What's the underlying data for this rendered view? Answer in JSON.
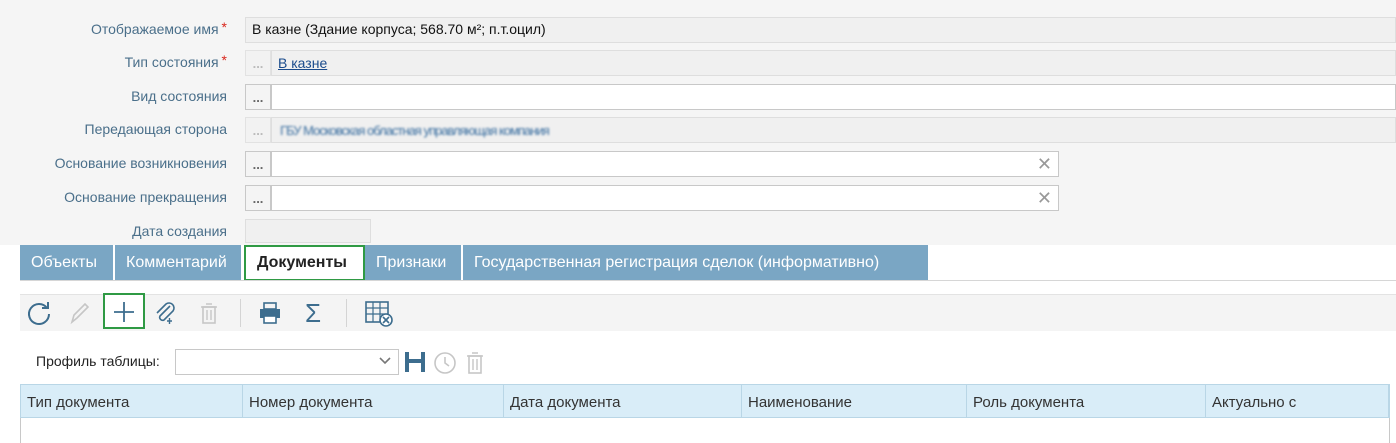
{
  "form": {
    "display_name": {
      "label": "Отображаемое имя",
      "required_mark": "*",
      "value": "В казне (Здание корпуса; 568.70 м²; п.т.оцил)"
    },
    "state_type": {
      "label": "Тип состояния",
      "required_mark": "*",
      "dots": "...",
      "value": "В казне"
    },
    "state_kind": {
      "label": "Вид состояния",
      "dots": "...",
      "value": ""
    },
    "transferring_party": {
      "label": "Передающая сторона",
      "dots": "...",
      "value": "ГБУ Московская областная управляющая компания"
    },
    "basis_origin": {
      "label": "Основание возникновения",
      "dots": "...",
      "value": "",
      "clear": "✕"
    },
    "basis_termination": {
      "label": "Основание прекращения",
      "dots": "...",
      "value": "",
      "clear": "✕"
    },
    "created_date": {
      "label": "Дата создания",
      "value": ""
    }
  },
  "tabs": [
    {
      "label": "Объекты",
      "active": false
    },
    {
      "label": "Комментарий",
      "active": false
    },
    {
      "label": "Документы",
      "active": true
    },
    {
      "label": "Признаки",
      "active": false
    },
    {
      "label": "Государственная регистрация сделок (информативно)",
      "active": false
    }
  ],
  "toolbar": {
    "refresh": "refresh-icon",
    "edit": "pencil-icon",
    "add": "plus-icon",
    "attach": "paperclip-icon",
    "delete": "trash-icon",
    "print": "printer-icon",
    "sum": "sigma-icon",
    "columns": "table-settings-icon"
  },
  "profile": {
    "label": "Профиль таблицы:",
    "value": ""
  },
  "grid": {
    "columns": [
      "Тип документа",
      "Номер документа",
      "Дата документа",
      "Наименование",
      "Роль документа",
      "Актуально с"
    ]
  },
  "colors": {
    "tab_bg": "#7aa6c4",
    "highlight": "#2f9a44",
    "grid_header": "#d9edf8",
    "label": "#4a6f8a"
  }
}
